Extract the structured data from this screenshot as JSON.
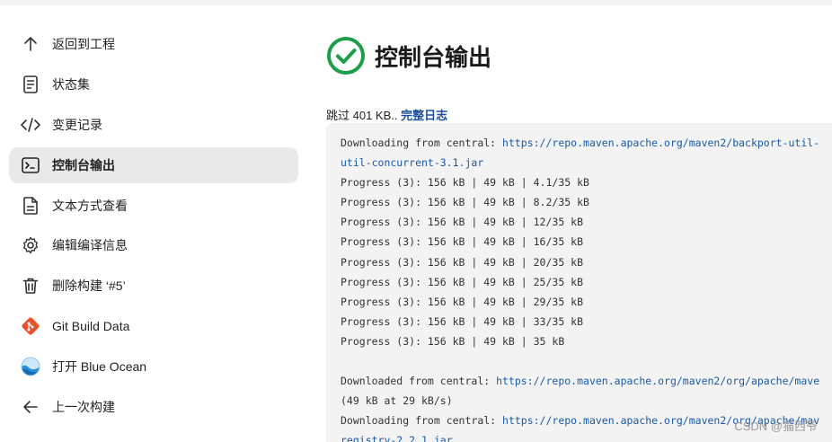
{
  "sidebar": {
    "items": [
      {
        "label": "返回到工程",
        "icon": "arrow-up-icon"
      },
      {
        "label": "状态集",
        "icon": "document-icon"
      },
      {
        "label": "变更记录",
        "icon": "code-icon"
      },
      {
        "label": "控制台输出",
        "icon": "terminal-icon",
        "active": true
      },
      {
        "label": "文本方式查看",
        "icon": "file-text-icon"
      },
      {
        "label": "编辑编译信息",
        "icon": "gear-icon"
      },
      {
        "label": "删除构建 ‘#5’",
        "icon": "trash-icon"
      },
      {
        "label": "Git Build Data",
        "icon": "git-icon"
      },
      {
        "label": "打开 Blue Ocean",
        "icon": "blue-ocean-icon"
      },
      {
        "label": "上一次构建",
        "icon": "arrow-left-icon"
      }
    ]
  },
  "main": {
    "title": "控制台输出",
    "skip_prefix": "跳过 401 KB.. ",
    "full_log_label": "完整日志"
  },
  "console": {
    "lines": [
      {
        "text": "Downloading from central: ",
        "link": "https://repo.maven.apache.org/maven2/backport-util-"
      },
      {
        "text": "",
        "link": "util-concurrent-3.1.jar"
      },
      {
        "text": "Progress (3): 156 kB | 49 kB | 4.1/35 kB"
      },
      {
        "text": "Progress (3): 156 kB | 49 kB | 8.2/35 kB"
      },
      {
        "text": "Progress (3): 156 kB | 49 kB | 12/35 kB"
      },
      {
        "text": "Progress (3): 156 kB | 49 kB | 16/35 kB"
      },
      {
        "text": "Progress (3): 156 kB | 49 kB | 20/35 kB"
      },
      {
        "text": "Progress (3): 156 kB | 49 kB | 25/35 kB"
      },
      {
        "text": "Progress (3): 156 kB | 49 kB | 29/35 kB"
      },
      {
        "text": "Progress (3): 156 kB | 49 kB | 33/35 kB"
      },
      {
        "text": "Progress (3): 156 kB | 49 kB | 35 kB"
      },
      {
        "text": ""
      },
      {
        "text": "Downloaded from central: ",
        "link": "https://repo.maven.apache.org/maven2/org/apache/mave"
      },
      {
        "text": "(49 kB at 29 kB/s)"
      },
      {
        "text": "Downloading from central: ",
        "link": "https://repo.maven.apache.org/maven2/org/apache/mav"
      },
      {
        "text": "",
        "link": "registry-2.2.1.jar"
      }
    ]
  },
  "watermark": "CSDN @猫西爷",
  "colors": {
    "success_green": "#1e9e4a",
    "link_blue": "#1b5aa8",
    "console_bg": "#f3f3f3",
    "active_bg": "#e9e9e9"
  }
}
